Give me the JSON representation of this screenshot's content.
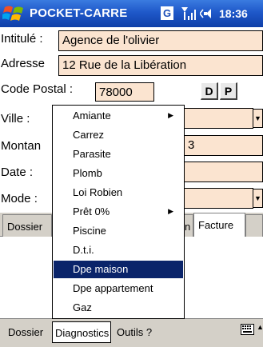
{
  "titlebar": {
    "app_title": "POCKET-CARRE",
    "badge": "G",
    "time": "18:36"
  },
  "form": {
    "intitule_label": "Intitulé :",
    "intitule_value": "Agence de l'olivier",
    "adresse_label": "Adresse",
    "adresse_value": "12 Rue de la Libération",
    "codepostal_label": "Code Postal :",
    "codepostal_value": "78000",
    "d_button": "D",
    "p_button": "P",
    "ville_label": "Ville :",
    "montant_label": "Montan",
    "montant_value_partial": "3",
    "date_label": "Date :",
    "mode_label": "Mode :"
  },
  "tabs": [
    {
      "label": "Dossier"
    },
    {
      "label": "n"
    },
    {
      "label": "Facture"
    }
  ],
  "dropdown": {
    "items": [
      {
        "label": "Amiante",
        "has_submenu": true
      },
      {
        "label": "Carrez",
        "has_submenu": false
      },
      {
        "label": "Parasite",
        "has_submenu": false
      },
      {
        "label": "Plomb",
        "has_submenu": false
      },
      {
        "label": "Loi Robien",
        "has_submenu": false
      },
      {
        "label": "Prêt 0%",
        "has_submenu": true
      },
      {
        "label": "Piscine",
        "has_submenu": false
      },
      {
        "label": "D.t.i.",
        "has_submenu": false
      },
      {
        "label": "Dpe maison",
        "has_submenu": false,
        "selected": true
      },
      {
        "label": "Dpe appartement",
        "has_submenu": false
      },
      {
        "label": "Gaz",
        "has_submenu": false
      }
    ]
  },
  "menubar": {
    "dossier": "Dossier",
    "diagnostics": "Diagnostics",
    "outils": "Outils ?"
  },
  "icons": {
    "start": "windows-start-icon",
    "signal": "signal-icon",
    "volume": "volume-icon",
    "keyboard": "keyboard-icon"
  },
  "colors": {
    "titlebar": "#1f58c9",
    "field_bg": "#fbe4d0",
    "selection": "#0a246a",
    "chrome": "#d4d0c8"
  }
}
